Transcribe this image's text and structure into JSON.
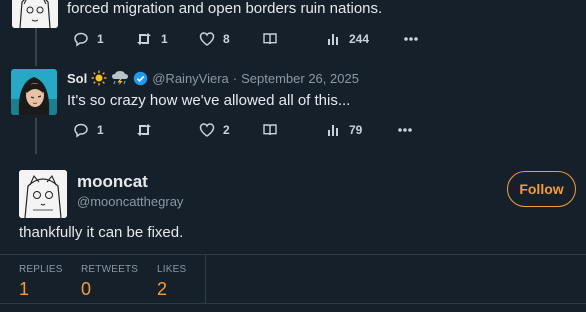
{
  "tweets": [
    {
      "text": "forced migration and open borders ruin nations.",
      "replies": "1",
      "retweets": "1",
      "likes": "8",
      "views": "244"
    },
    {
      "name": "Sol",
      "badges": [
        "sun-emoji",
        "thunderstorm-emoji",
        "verified-badge"
      ],
      "handle": "@RainyViera",
      "separator": "·",
      "date": "September 26, 2025",
      "text": "It's so crazy how we've allowed all of this...",
      "replies": "1",
      "retweets": "",
      "likes": "2",
      "views": "79"
    }
  ],
  "main_tweet": {
    "name": "mooncat",
    "handle": "@mooncatthegray",
    "follow_label": "Follow",
    "text": "thankfully it can be fixed.",
    "stats": [
      {
        "label": "REPLIES",
        "value": "1"
      },
      {
        "label": "RETWEETS",
        "value": "0"
      },
      {
        "label": "LIKES",
        "value": "2"
      }
    ]
  },
  "colors": {
    "background": "#15202b",
    "accent": "#f29d38",
    "verified": "#1d9bf0",
    "muted": "#8b98a5"
  }
}
